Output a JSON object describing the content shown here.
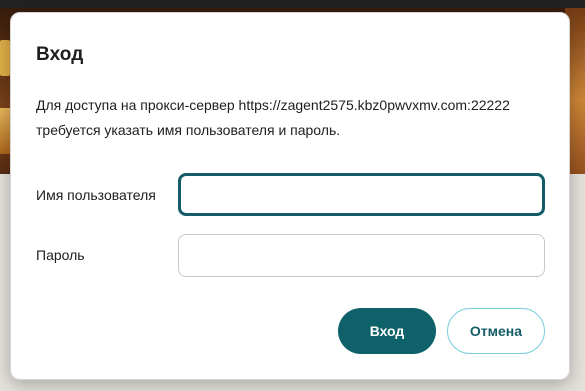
{
  "dialog": {
    "title": "Вход",
    "message": "Для доступа на прокси-сервер https://zagent2575.kbz0pwvxmv.com:22222 требуется указать имя пользователя и пароль.",
    "username_label": "Имя пользователя",
    "username_value": "",
    "password_label": "Пароль",
    "password_value": "",
    "login_button": "Вход",
    "cancel_button": "Отмена"
  },
  "colors": {
    "primary": "#0e6169",
    "focus_border": "#145d68",
    "cancel_border": "#7ecfe0"
  }
}
